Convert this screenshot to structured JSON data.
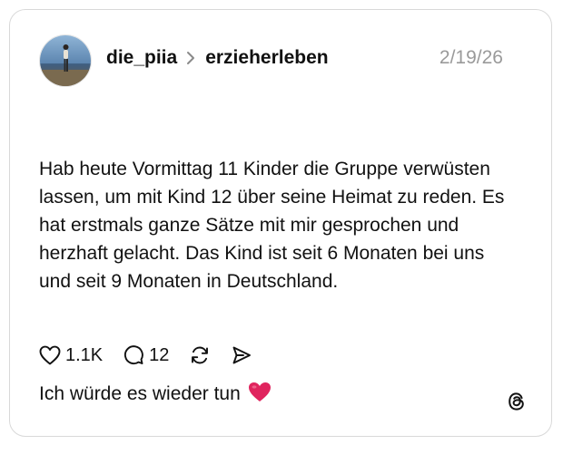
{
  "post": {
    "author": "die_piia",
    "community": "erzieherleben",
    "date": "2/19/26",
    "paragraph1": "Hab heute Vormittag 11 Kinder die Gruppe verwüsten lassen, um mit Kind 12 über seine Heimat zu reden. Es hat erstmals ganze Sätze mit mir gesprochen und herzhaft gelacht. Das Kind ist seit 6 Monaten bei uns und seit 9 Monaten in Deutschland.",
    "paragraph2": "Ich würde es wieder tun",
    "emoji": "red-heart"
  },
  "actions": {
    "likes": "1.1K",
    "replies": "12"
  },
  "icons": {
    "avatar": "avatar-photo",
    "separator": "chevron-right-icon",
    "like": "heart-icon",
    "reply": "comment-bubble-icon",
    "repost": "repost-icon",
    "share": "send-icon",
    "brand": "threads-logo-icon"
  },
  "colors": {
    "text": "#111111",
    "muted": "#9a9a9a",
    "border": "#d9d9d9",
    "heart": "#e0245e"
  }
}
